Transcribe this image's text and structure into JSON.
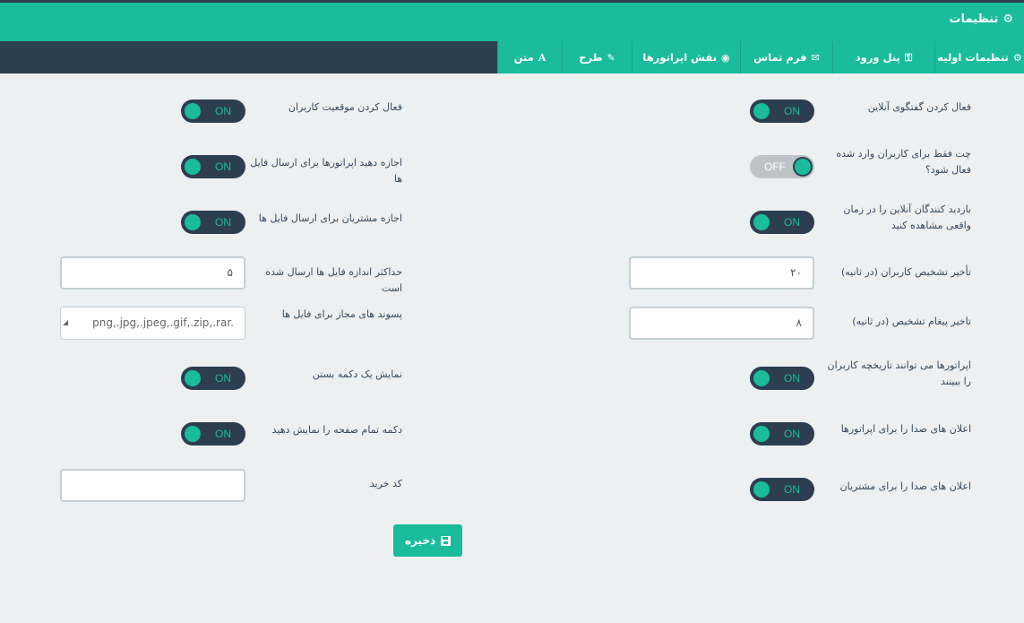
{
  "header": {
    "title": "تنظیمات",
    "icon": "gears-icon"
  },
  "tabs": [
    {
      "label": "تنظیمات اولیه",
      "icon": "gears-icon",
      "glyph": "⚙"
    },
    {
      "label": "پنل ورود",
      "icon": "key-icon",
      "glyph": "⚿"
    },
    {
      "label": "فرم تماس",
      "icon": "envelope-icon",
      "glyph": "✉"
    },
    {
      "label": "نقش اپراتورها",
      "icon": "user-circle-icon",
      "glyph": "◉"
    },
    {
      "label": "طرح",
      "icon": "paint-brush-icon",
      "glyph": "✎"
    },
    {
      "label": "متن",
      "icon": "font-icon",
      "glyph": "A"
    }
  ],
  "right_column": {
    "online_chat": {
      "label": "فعال کردن گفتگوی آنلاین",
      "state": "ON"
    },
    "chat_logged_in_only": {
      "label": "چت فقط برای کاربران وارد شده فعال شود؟",
      "state": "OFF"
    },
    "realtime_visitors": {
      "label": "بازدید کنندگان آنلاین را در زمان واقعی مشاهده کنید",
      "state": "ON"
    },
    "user_detect_delay": {
      "label": "تأخیر تشخیص کاربران (در ثانیه)",
      "value": "۲۰"
    },
    "message_detect_delay": {
      "label": "تاخیر پیغام تشخیص (در ثانیه)",
      "value": "۸"
    },
    "operators_view_history": {
      "label": "اپراتورها می توانند تاریخچه کاربران را ببینند",
      "state": "ON"
    },
    "sound_operators": {
      "label": "اعلان های صدا را برای اپراتورها",
      "state": "ON"
    },
    "sound_customers": {
      "label": "اعلان های صدا را برای مشتریان",
      "state": "ON"
    }
  },
  "left_column": {
    "user_location": {
      "label": "فعال کردن موقعیت کاربران",
      "state": "ON"
    },
    "operators_send_files": {
      "label": "اجازه دهید اپراتورها برای ارسال فایل ها",
      "state": "ON"
    },
    "customers_send_files": {
      "label": "اجازه مشتریان برای ارسال فایل ها",
      "state": "ON"
    },
    "max_file_size": {
      "label": "حداکثر اندازه فایل ها ارسال شده است",
      "value": "۵"
    },
    "allowed_extensions": {
      "label": "پسوند های مجاز برای فایل ها",
      "value": "png,.jpg,.jpeg,.gif,.zip,.rar."
    },
    "close_button": {
      "label": "نمایش یک دکمه بستن",
      "state": "ON"
    },
    "fullscreen_button": {
      "label": "دکمه تمام صفحه را نمایش دهید",
      "state": "ON"
    },
    "purchase_code": {
      "label": "کد خرید",
      "value": ""
    }
  },
  "save_button": {
    "label": "ذخیره",
    "icon": "floppy-disk-icon"
  },
  "colors": {
    "accent": "#1abc9c",
    "dark": "#2c3e50",
    "background": "#ecf0f1"
  }
}
